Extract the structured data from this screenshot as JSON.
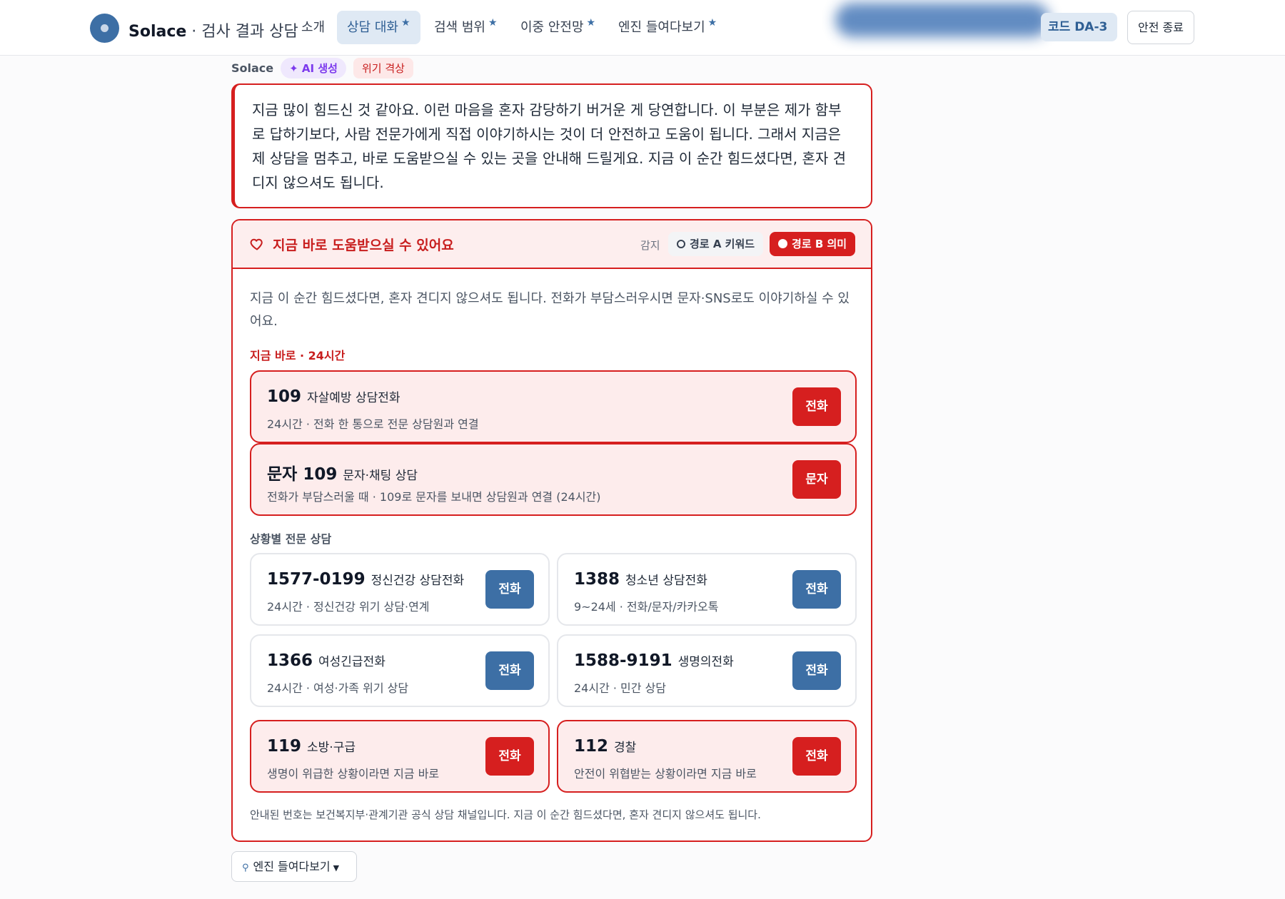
{
  "header": {
    "brand_name": "Solace",
    "brand_sep": " · ",
    "brand_sub": "검사 결과 상담",
    "nav": [
      {
        "label": "소개",
        "starred": false
      },
      {
        "label": "상담 대화",
        "starred": true,
        "active": true
      },
      {
        "label": "검색 범위",
        "starred": true
      },
      {
        "label": "이중 안전망",
        "starred": true
      },
      {
        "label": "엔진 들여다보기",
        "starred": true
      }
    ],
    "star": "★",
    "code_badge": "코드 DA-3",
    "exit_label": "안전 종료"
  },
  "message": {
    "sender": "Solace",
    "ai_tag": "✦ AI 생성",
    "crisis_tag": "위기 격상",
    "body": "지금 많이 힘드신 것 같아요. 이런 마음을 혼자 감당하기 버거운 게 당연합니다. 이 부분은 제가 함부로 답하기보다, 사람 전문가에게 직접 이야기하시는 것이 더 안전하고 도움이 됩니다. 그래서 지금은 제 상담을 멈추고, 바로 도움받으실 수 있는 곳을 안내해 드릴게요. 지금 이 순간 힘드셨다면, 혼자 견디지 않으셔도 됩니다."
  },
  "panel": {
    "title": "지금 바로 도움받으실 수 있어요",
    "detect_label": "감지",
    "route_a": "경로 A 키워드",
    "route_b": "경로 B 의미",
    "intro": "지금 이 순간 힘드셨다면, 혼자 견디지 않으셔도 됩니다. 전화가 부담스러우시면 문자·SNS로도 이야기하실 수 있어요.",
    "section_now": "지금 바로 · 24시간",
    "section_special": "상황별 전문 상담",
    "cards": [
      {
        "number": "109",
        "label": "자살예방 상담전화",
        "desc": "24시간 · 전화 한 통으로 전문 상담원과 연결",
        "action": "전화"
      },
      {
        "number": "문자 109",
        "label": "문자·채팅 상담",
        "desc": "전화가 부담스러울 때 · 109로 문자를 보내면 상담원과 연결 (24시간)",
        "action": "문자"
      },
      {
        "number": "1577-0199",
        "label": "정신건강 상담전화",
        "desc": "24시간 · 정신건강 위기 상담·연계",
        "action": "전화"
      },
      {
        "number": "1388",
        "label": "청소년 상담전화",
        "desc": "9~24세 · 전화/문자/카카오톡",
        "action": "전화"
      },
      {
        "number": "1366",
        "label": "여성긴급전화",
        "desc": "24시간 · 여성·가족 위기 상담",
        "action": "전화"
      },
      {
        "number": "1588-9191",
        "label": "생명의전화",
        "desc": "24시간 · 민간 상담",
        "action": "전화"
      },
      {
        "number": "119",
        "label": "소방·구급",
        "desc": "생명이 위급한 상황이라면 지금 바로",
        "action": "전화"
      },
      {
        "number": "112",
        "label": "경찰",
        "desc": "안전이 위협받는 상황이라면 지금 바로",
        "action": "전화"
      }
    ],
    "footnote": "안내된 번호는 보건복지부·관계기관 공식 상담 채널입니다. 지금 이 순간 힘드셨다면, 혼자 견디지 않으셔도 됩니다."
  },
  "engine": {
    "key_icon": "⚲",
    "label": "엔진 들여다보기",
    "caret": "▼"
  },
  "colors": {
    "accent_blue": "#3d6fa5",
    "crisis_red": "#d61f1f",
    "ai_purple": "#7c3aed"
  }
}
